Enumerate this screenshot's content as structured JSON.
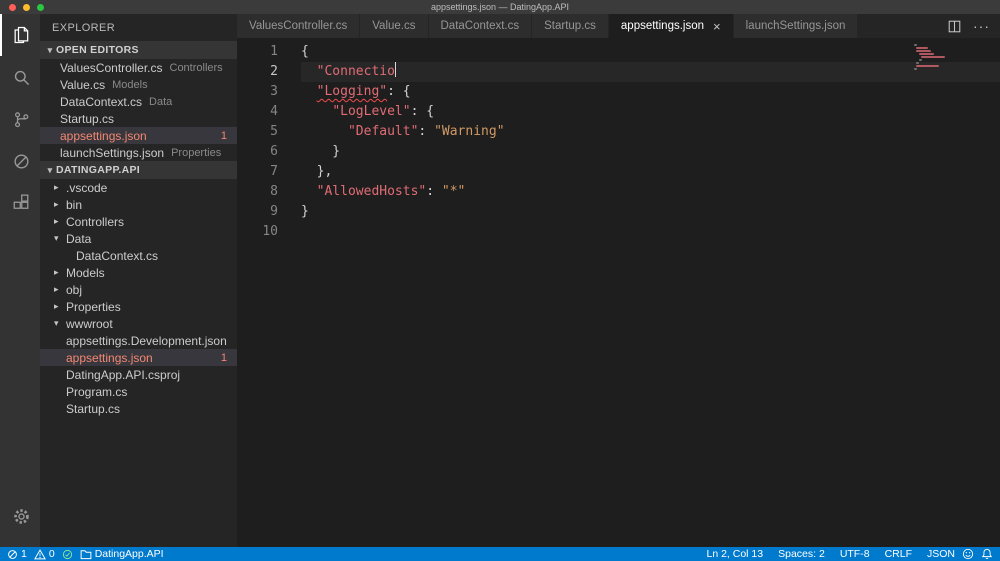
{
  "theme": {
    "accent": "#007acc",
    "key_color": "#e06c75",
    "string_color": "#d19a66",
    "punct_color": "#d4d4d4",
    "error_file_color": "#f48771",
    "squiggle_color": "#f14c4c",
    "editor_bg": "#1e1e1e",
    "sidebar_bg": "#252526",
    "activity_bg": "#333333"
  },
  "title_bar": {
    "title": "appsettings.json — DatingApp.API"
  },
  "activity_bar": {
    "icons": [
      "explorer-icon",
      "search-icon",
      "source-control-icon",
      "debug-icon",
      "extensions-icon",
      "settings-gear-icon"
    ]
  },
  "sidebar": {
    "title": "EXPLORER",
    "sections": [
      {
        "label": "OPEN EDITORS",
        "items": [
          {
            "name": "ValuesController.cs",
            "detail": "Controllers"
          },
          {
            "name": "Value.cs",
            "detail": "Models"
          },
          {
            "name": "DataContext.cs",
            "detail": "Data"
          },
          {
            "name": "Startup.cs",
            "detail": ""
          },
          {
            "name": "appsettings.json",
            "detail": "",
            "error": true,
            "badge": "1",
            "selected": true
          },
          {
            "name": "launchSettings.json",
            "detail": "Properties"
          }
        ]
      },
      {
        "label": "DATINGAPP.API",
        "items": [
          {
            "name": ".vscode",
            "kind": "folder",
            "arrow": "collapsed",
            "indent": 0
          },
          {
            "name": "bin",
            "kind": "folder",
            "arrow": "collapsed",
            "indent": 0
          },
          {
            "name": "Controllers",
            "kind": "folder",
            "arrow": "collapsed",
            "indent": 0
          },
          {
            "name": "Data",
            "kind": "folder",
            "arrow": "expanded",
            "indent": 0
          },
          {
            "name": "DataContext.cs",
            "kind": "file",
            "indent": 1
          },
          {
            "name": "Models",
            "kind": "folder",
            "arrow": "collapsed",
            "indent": 0
          },
          {
            "name": "obj",
            "kind": "folder",
            "arrow": "collapsed",
            "indent": 0
          },
          {
            "name": "Properties",
            "kind": "folder",
            "arrow": "collapsed",
            "indent": 0
          },
          {
            "name": "wwwroot",
            "kind": "folder",
            "arrow": "expanded",
            "indent": 0
          },
          {
            "name": "appsettings.Development.json",
            "kind": "file",
            "indent": 0
          },
          {
            "name": "appsettings.json",
            "kind": "file",
            "indent": 0,
            "error": true,
            "badge": "1",
            "selected": true
          },
          {
            "name": "DatingApp.API.csproj",
            "kind": "file",
            "indent": 0
          },
          {
            "name": "Program.cs",
            "kind": "file",
            "indent": 0
          },
          {
            "name": "Startup.cs",
            "kind": "file",
            "indent": 0
          }
        ]
      }
    ]
  },
  "tabs": [
    {
      "label": "ValuesController.cs",
      "active": false
    },
    {
      "label": "Value.cs",
      "active": false
    },
    {
      "label": "DataContext.cs",
      "active": false
    },
    {
      "label": "Startup.cs",
      "active": false
    },
    {
      "label": "appsettings.json",
      "active": true,
      "close": "×"
    },
    {
      "label": "launchSettings.json",
      "active": false
    }
  ],
  "tab_actions": {
    "more": "···"
  },
  "editor": {
    "language": "json",
    "cursor_line": 2,
    "lines": [
      {
        "n": 1,
        "tokens": [
          {
            "s": "{",
            "t": "p"
          }
        ]
      },
      {
        "n": 2,
        "tokens": [
          {
            "s": "  ",
            "t": "p"
          },
          {
            "s": "\"Connectio",
            "t": "k",
            "cursor": true
          }
        ]
      },
      {
        "n": 3,
        "tokens": [
          {
            "s": "  ",
            "t": "p"
          },
          {
            "s": "\"Logging\"",
            "t": "k",
            "squiggle": true
          },
          {
            "s": ": {",
            "t": "p"
          }
        ]
      },
      {
        "n": 4,
        "tokens": [
          {
            "s": "    ",
            "t": "p"
          },
          {
            "s": "\"LogLevel\"",
            "t": "k"
          },
          {
            "s": ": {",
            "t": "p"
          }
        ]
      },
      {
        "n": 5,
        "tokens": [
          {
            "s": "      ",
            "t": "p"
          },
          {
            "s": "\"Default\"",
            "t": "k"
          },
          {
            "s": ": ",
            "t": "p"
          },
          {
            "s": "\"Warning\"",
            "t": "v"
          }
        ]
      },
      {
        "n": 6,
        "tokens": [
          {
            "s": "    }",
            "t": "p"
          }
        ]
      },
      {
        "n": 7,
        "tokens": [
          {
            "s": "  },",
            "t": "p"
          }
        ]
      },
      {
        "n": 8,
        "tokens": [
          {
            "s": "  ",
            "t": "p"
          },
          {
            "s": "\"AllowedHosts\"",
            "t": "k"
          },
          {
            "s": ": ",
            "t": "p"
          },
          {
            "s": "\"*\"",
            "t": "v"
          }
        ]
      },
      {
        "n": 9,
        "tokens": [
          {
            "s": "}",
            "t": "p"
          }
        ]
      },
      {
        "n": 10,
        "tokens": []
      }
    ]
  },
  "status_bar": {
    "errors": "1",
    "warnings": "0",
    "project": "DatingApp.API",
    "right_items": [
      "Ln 2, Col 13",
      "Spaces: 2",
      "UTF-8",
      "CRLF",
      "JSON"
    ],
    "icons": [
      "errors-icon",
      "warnings-icon",
      "check-status-icon",
      "folder-icon",
      "feedback-smiley-icon",
      "notifications-bell-icon"
    ]
  }
}
